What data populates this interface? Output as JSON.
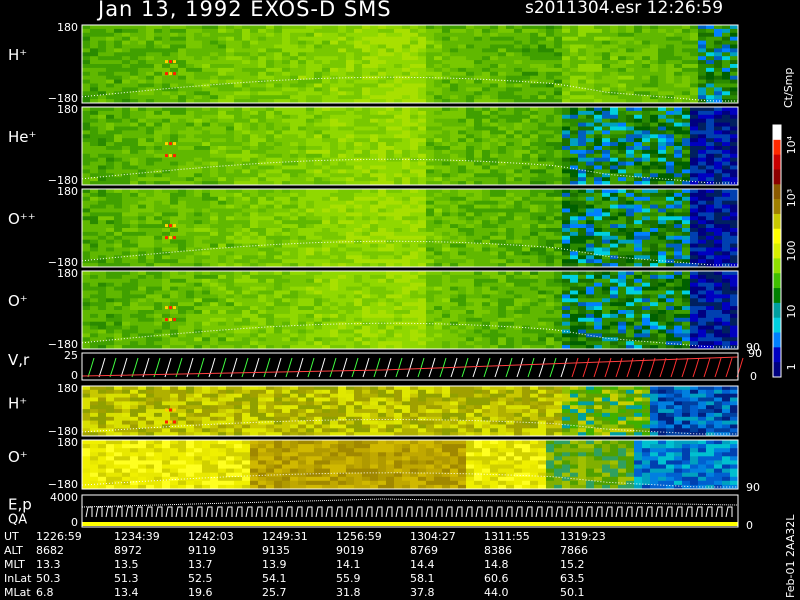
{
  "header": {
    "title_left": "Jan 13, 1992   EXOS-D SMS",
    "title_right": "s2011304.esr  12:26:59"
  },
  "colorbar": {
    "units": "Ct/Smp",
    "tick_labels": [
      "10⁴",
      "10³",
      "100",
      "10",
      "1"
    ],
    "colors": [
      "#ffffff",
      "#ff2a00",
      "#c80000",
      "#8b0000",
      "#8b5a00",
      "#a08000",
      "#c8c800",
      "#ffff00",
      "#d8f000",
      "#90e000",
      "#40c000",
      "#008000",
      "#00a0a0",
      "#00d0e0",
      "#0080ff",
      "#0000c0",
      "#000080"
    ]
  },
  "chart_data": [
    {
      "type": "heatmap",
      "name": "H⁺",
      "ylabel": "H⁺",
      "yticks": [
        "180",
        "−180"
      ],
      "ylim": [
        -180,
        180
      ]
    },
    {
      "type": "heatmap",
      "name": "He⁺",
      "ylabel": "He⁺",
      "yticks": [
        "180",
        "−180"
      ],
      "ylim": [
        -180,
        180
      ]
    },
    {
      "type": "heatmap",
      "name": "O⁺⁺",
      "ylabel": "O⁺⁺",
      "yticks": [
        "180",
        "−180"
      ],
      "ylim": [
        -180,
        180
      ]
    },
    {
      "type": "heatmap",
      "name": "O⁺",
      "ylabel": "O⁺",
      "yticks": [
        "180",
        "−180"
      ],
      "ylim": [
        -180,
        180
      ],
      "right_tick": "90"
    },
    {
      "type": "line",
      "name": "V,r",
      "ylabel": "V,r",
      "yticks": [
        "25",
        "0"
      ],
      "ylim": [
        0,
        25
      ],
      "right_ticks": [
        "90",
        "0"
      ]
    },
    {
      "type": "heatmap",
      "name": "H⁺ (2)",
      "ylabel": "H⁺",
      "yticks": [
        "180",
        "−180"
      ],
      "ylim": [
        -180,
        180
      ]
    },
    {
      "type": "heatmap",
      "name": "O⁺ (2)",
      "ylabel": "O⁺",
      "yticks": [
        "180",
        "−180"
      ],
      "ylim": [
        -180,
        180
      ],
      "right_tick": "90"
    },
    {
      "type": "line",
      "name": "E,p QA",
      "ylabel": "E,p",
      "ylabel2": "QA",
      "yticks": [
        "4000",
        "0"
      ],
      "ylim": [
        0,
        4000
      ],
      "right_tick": "0"
    }
  ],
  "table": {
    "rows": [
      {
        "label": "UT",
        "values": [
          "1226:59",
          "1234:39",
          "1242:03",
          "1249:31",
          "1256:59",
          "1304:27",
          "1311:55",
          "1319:23"
        ]
      },
      {
        "label": "ALT",
        "values": [
          "8682",
          "8972",
          "9119",
          "9135",
          "9019",
          "8769",
          "8386",
          "7866"
        ]
      },
      {
        "label": "MLT",
        "values": [
          "13.3",
          "13.5",
          "13.7",
          "13.9",
          "14.1",
          "14.4",
          "14.8",
          "15.2"
        ]
      },
      {
        "label": "InLat",
        "values": [
          "50.3",
          "51.3",
          "52.5",
          "54.1",
          "55.9",
          "58.1",
          "60.6",
          "63.5"
        ]
      },
      {
        "label": "MLat",
        "values": [
          "6.8",
          "13.4",
          "19.6",
          "25.7",
          "31.8",
          "37.8",
          "44.0",
          "50.1"
        ]
      }
    ]
  },
  "footer": {
    "version": "Feb-01 2AA32L"
  }
}
